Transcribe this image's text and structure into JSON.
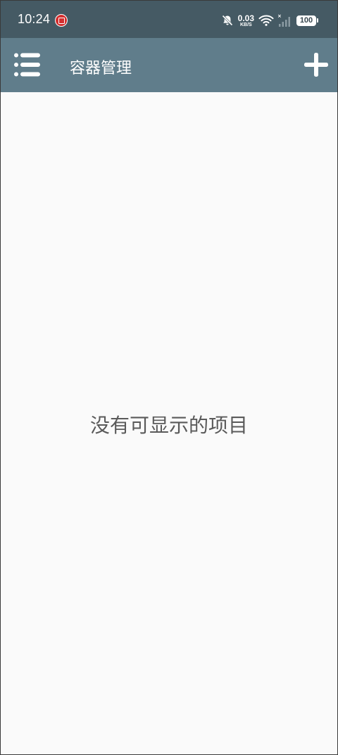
{
  "status_bar": {
    "time": "10:24",
    "app_icon": "red-app-notification-icon",
    "bell_icon": "bell-muted-icon",
    "net_speed_value": "0.03",
    "net_speed_unit": "KB/S",
    "wifi_icon": "wifi-icon",
    "signal_icon": "signal-no-service-icon",
    "battery_level": "100"
  },
  "app_bar": {
    "menu_icon": "list-menu-icon",
    "title": "容器管理",
    "add_icon": "plus-icon",
    "background_color": "#607d8b",
    "status_bar_color": "#455a64"
  },
  "content": {
    "empty_message": "没有可显示的项目"
  }
}
